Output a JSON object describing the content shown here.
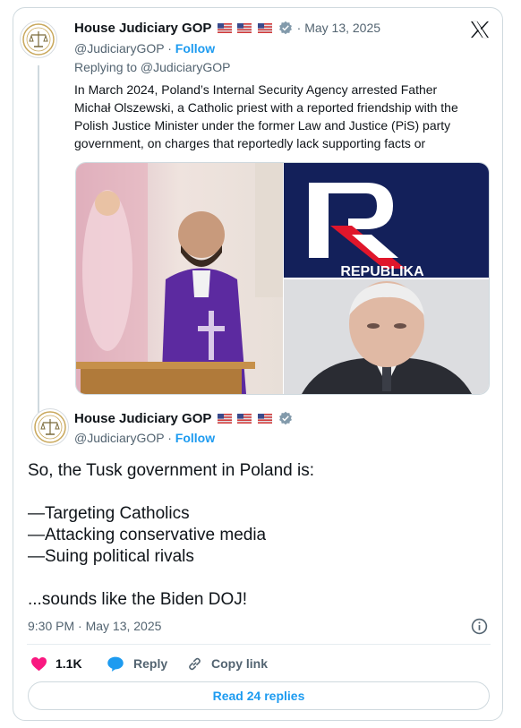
{
  "quoted_tweet": {
    "author_name": "House Judiciary GOP",
    "handle": "@JudiciaryGOP",
    "dot": "·",
    "follow_label": "Follow",
    "date": "· May 13, 2025",
    "replying_to": "Replying to @JudiciaryGOP",
    "text_lines": [
      "In March 2024, Poland’s Internal Security Agency arrested Father",
      "Michał Olszewski, a Catholic priest with a reported friendship with the",
      "Polish Justice Minister under the former Law and Justice (PiS) party",
      "government, on charges that reportedly lack supporting facts or"
    ],
    "media": {
      "logo_text": "REPUBLIKA",
      "images": [
        "priest-photo",
        "republika-logo",
        "politician-portrait"
      ]
    }
  },
  "main_tweet": {
    "author_name": "House Judiciary GOP",
    "handle": "@JudiciaryGOP",
    "dot": "·",
    "follow_label": "Follow",
    "text": "So, the Tusk government in Poland is:\n\n—Targeting Catholics\n—Attacking conservative media\n—Suing political rivals\n\n...sounds like the Biden DOJ!",
    "timestamp": "9:30 PM · May 13, 2025"
  },
  "actions": {
    "like_count": "1.1K",
    "reply_label": "Reply",
    "copy_link_label": "Copy link"
  },
  "read_replies_label": "Read 24 replies",
  "icons": {
    "x_logo": "x-logo-icon",
    "verified": "verified-badge-icon",
    "flag": "us-flag-icon",
    "info": "info-icon",
    "heart": "heart-icon",
    "reply": "reply-bubble-icon",
    "link": "link-icon"
  },
  "colors": {
    "accent": "#1d9bf0",
    "heart": "#f91880",
    "text": "#0f1419",
    "muted": "#536471",
    "border": "#cfd9de"
  }
}
